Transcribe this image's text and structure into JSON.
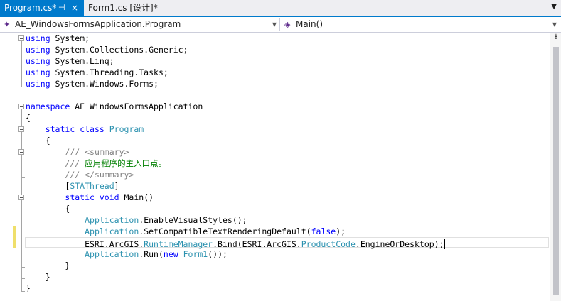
{
  "tabs": [
    {
      "label": "Program.cs*",
      "pin_icon": "⊣",
      "close_icon": "×"
    },
    {
      "label": "Form1.cs [设计]*"
    }
  ],
  "tab_overflow_icon": "▼",
  "navbar": {
    "type_label": "AE_WindowsFormsApplication.Program",
    "member_label": "Main()"
  },
  "code": {
    "l1": [
      "using",
      " System;"
    ],
    "l2": [
      "using",
      " System.Collections.Generic;"
    ],
    "l3": [
      "using",
      " System.Linq;"
    ],
    "l4": [
      "using",
      " System.Threading.Tasks;"
    ],
    "l5": [
      "using",
      " System.Windows.Forms;"
    ],
    "l7": [
      "namespace",
      " AE_WindowsFormsApplication"
    ],
    "l8": "{",
    "l9": [
      "    ",
      "static",
      " ",
      "class",
      " ",
      "Program"
    ],
    "l10": "    {",
    "l11": [
      "        ",
      "///",
      " ",
      "<summary>"
    ],
    "l12": [
      "        ",
      "///",
      " 应用程序的主入口点。"
    ],
    "l13": [
      "        ",
      "///",
      " ",
      "</summary>"
    ],
    "l14": [
      "        [",
      "STAThread",
      "]"
    ],
    "l15": [
      "        ",
      "static",
      " ",
      "void",
      " Main()"
    ],
    "l16": "        {",
    "l17": [
      "            ",
      "Application",
      ".EnableVisualStyles();"
    ],
    "l18": [
      "            ",
      "Application",
      ".SetCompatibleTextRenderingDefault(",
      "false",
      ");"
    ],
    "l19": [
      "            ESRI.ArcGIS.",
      "RuntimeManager",
      ".Bind(ESRI.ArcGIS.",
      "ProductCode",
      ".EngineOrDesktop);"
    ],
    "l20": [
      "            ",
      "Application",
      ".Run(",
      "new",
      " ",
      "Form1",
      "());"
    ],
    "l21": "        }",
    "l22": "    }",
    "l23": "}"
  },
  "colors": {
    "keyword": "#0000ff",
    "type": "#2b91af",
    "comment": "#008000",
    "tab_active": "#007acc",
    "change_marker": "#efdf6b"
  }
}
